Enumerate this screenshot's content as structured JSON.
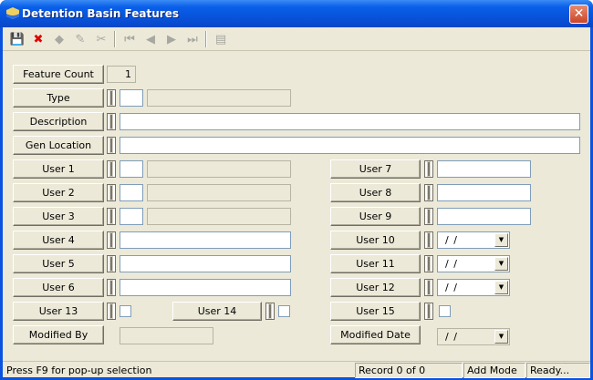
{
  "window": {
    "title": "Detention Basin Features",
    "close": "✕"
  },
  "toolbar": {
    "items": [
      {
        "name": "save-icon",
        "glyph": "💾",
        "color": "#1a2fa0",
        "enabled": true
      },
      {
        "name": "delete-icon",
        "glyph": "✖",
        "color": "#e00000",
        "enabled": true
      },
      {
        "name": "eraser-icon",
        "glyph": "◆",
        "color": "#a8a8a0",
        "enabled": false
      },
      {
        "name": "pencil-icon",
        "glyph": "✎",
        "color": "#a8a8a0",
        "enabled": false
      },
      {
        "name": "scissors-icon",
        "glyph": "✂",
        "color": "#a8a8a0",
        "enabled": false
      },
      {
        "name": "first-record-icon",
        "glyph": "⏮",
        "color": "#a8a8a0",
        "enabled": false
      },
      {
        "name": "previous-record-icon",
        "glyph": "◀",
        "color": "#a8a8a0",
        "enabled": false
      },
      {
        "name": "next-record-icon",
        "glyph": "▶",
        "color": "#a8a8a0",
        "enabled": false
      },
      {
        "name": "last-record-icon",
        "glyph": "⏭",
        "color": "#a8a8a0",
        "enabled": false
      },
      {
        "name": "report-icon",
        "glyph": "▤",
        "color": "#a8a8a0",
        "enabled": false
      }
    ]
  },
  "form": {
    "feature_count": {
      "label": "Feature Count",
      "value": "1"
    },
    "type": {
      "label": "Type"
    },
    "description": {
      "label": "Description",
      "value": ""
    },
    "gen_location": {
      "label": "Gen Location",
      "value": ""
    },
    "user1": {
      "label": "User 1"
    },
    "user2": {
      "label": "User 2"
    },
    "user3": {
      "label": "User 3"
    },
    "user4": {
      "label": "User 4",
      "value": ""
    },
    "user5": {
      "label": "User 5",
      "value": ""
    },
    "user6": {
      "label": "User 6",
      "value": ""
    },
    "user7": {
      "label": "User 7",
      "value": ""
    },
    "user8": {
      "label": "User 8",
      "value": ""
    },
    "user9": {
      "label": "User 9",
      "value": ""
    },
    "user10": {
      "label": "User 10",
      "value": "/ /"
    },
    "user11": {
      "label": "User 11",
      "value": "/ /"
    },
    "user12": {
      "label": "User 12",
      "value": "/ /"
    },
    "user13": {
      "label": "User 13"
    },
    "user14": {
      "label": "User 14"
    },
    "user15": {
      "label": "User 15"
    },
    "modified_by": {
      "label": "Modified By",
      "value": ""
    },
    "modified_date": {
      "label": "Modified Date",
      "value": "/ /"
    }
  },
  "status": {
    "hint": "Press F9 for pop-up selection",
    "record": "Record 0 of 0",
    "mode": "Add Mode",
    "state": "Ready..."
  }
}
